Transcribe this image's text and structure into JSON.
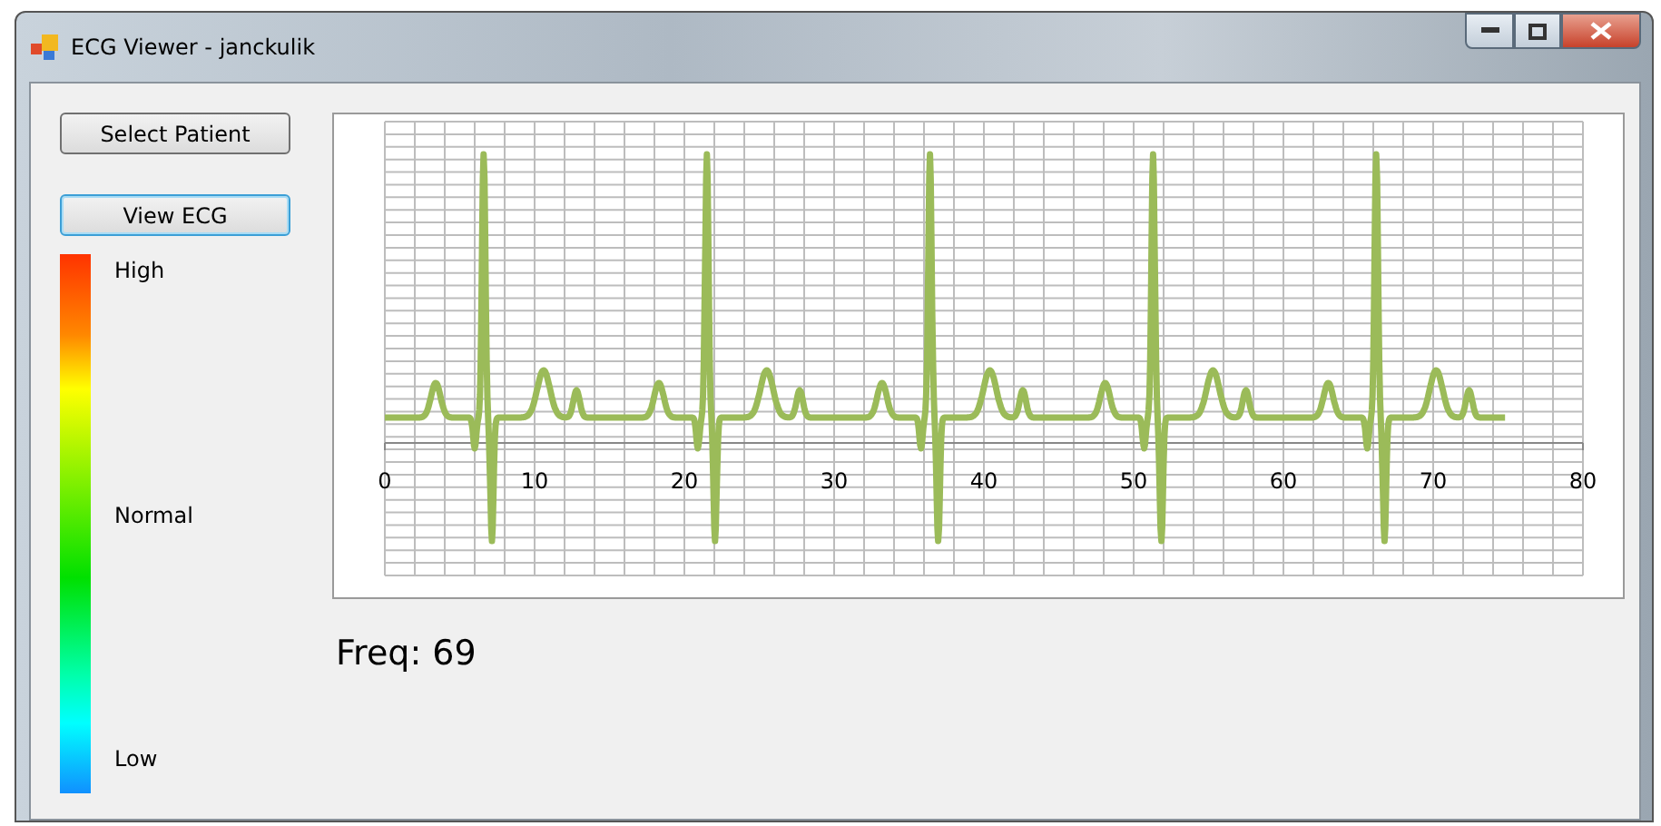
{
  "window": {
    "title": "ECG Viewer - janckulik"
  },
  "buttons": [
    {
      "label": "Select Patient",
      "focused": false
    },
    {
      "label": "View ECG",
      "focused": true
    }
  ],
  "scale_labels": [
    "High",
    "Normal",
    "Low"
  ],
  "chart": {
    "x_tick_labels": [
      "0",
      "10",
      "20",
      "30",
      "40",
      "50",
      "60",
      "70",
      "80"
    ]
  },
  "frequency": "Freq: 69"
}
